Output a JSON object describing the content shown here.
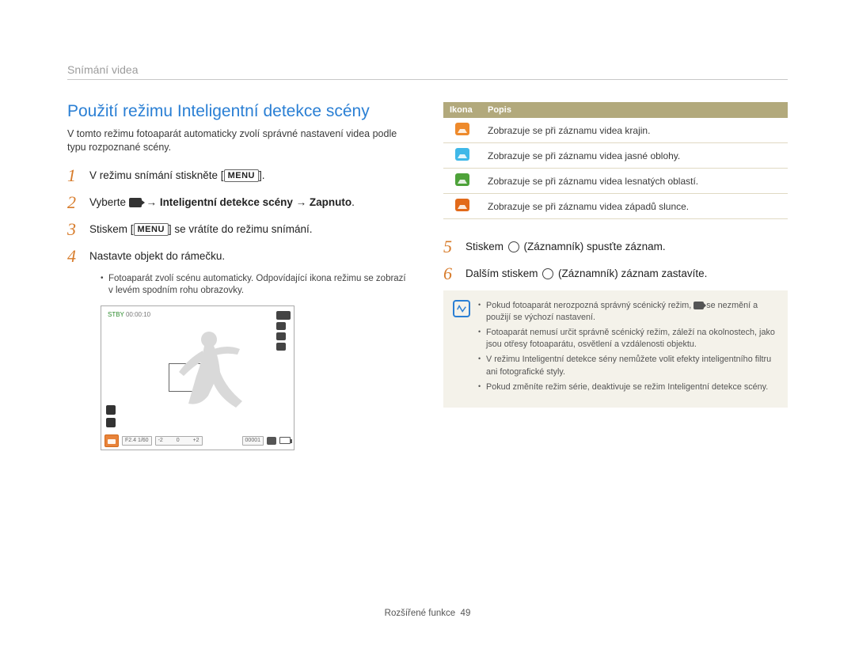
{
  "section_label": "Snímání videa",
  "heading": "Použití režimu Inteligentní detekce scény",
  "intro": "V tomto režimu fotoaparát automaticky zvolí správné nastavení videa podle typu rozpoznané scény.",
  "menu_label": "MENU",
  "steps": {
    "s1_pre": "V režimu snímání stiskněte [",
    "s1_post": "].",
    "s2_pre": "Vyberte ",
    "s2_mid": " → ",
    "s2_b1": "Inteligentní detekce scény",
    "s2_b2": "Zapnuto",
    "s2_end": ".",
    "s3_pre": "Stiskem [",
    "s3_post": "] se vrátíte do režimu snímání.",
    "s4": "Nastavte objekt do rámečku.",
    "s4_sub": "Fotoaparát zvolí scénu automaticky. Odpovídající ikona režimu se zobrazí v levém spodním rohu obrazovky.",
    "s5_pre": "Stiskem ",
    "s5_mid": " (Záznamník) spusťte záznam.",
    "s6_pre": "Dalším stiskem ",
    "s6_mid": " (Záznamník) záznam zastavíte."
  },
  "preview": {
    "stby": "STBY",
    "time": "00:00:10",
    "exposure": "F2.4  1/60",
    "counter": "00001"
  },
  "table": {
    "h1": "Ikona",
    "h2": "Popis",
    "rows": [
      "Zobrazuje se při záznamu videa krajin.",
      "Zobrazuje se při záznamu videa jasné oblohy.",
      "Zobrazuje se při záznamu videa lesnatých oblastí.",
      "Zobrazuje se při záznamu videa západů slunce."
    ]
  },
  "note": {
    "n1a": "Pokud fotoaparát nerozpozná správný scénický režim, ",
    "n1b": " se nezmění a použijí se výchozí nastavení.",
    "n2": "Fotoaparát nemusí určit správně scénický režim, záleží na okolnostech, jako jsou otřesy fotoaparátu, osvětlení a vzdálenosti objektu.",
    "n3": "V režimu Inteligentní detekce sény nemůžete volit efekty inteligentního filtru ani fotografické styly.",
    "n4": "Pokud změníte režim série, deaktivuje se režim Inteligentní detekce scény."
  },
  "footer": {
    "label": "Rozšířené funkce",
    "page": "49"
  }
}
